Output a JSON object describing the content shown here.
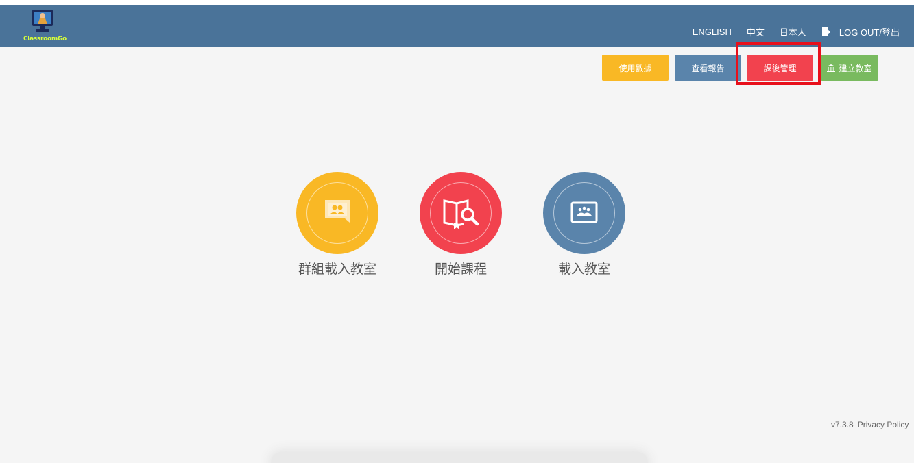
{
  "app": {
    "logo_text": "ClassroomGo"
  },
  "nav": {
    "english": "ENGLISH",
    "chinese": "中文",
    "japanese": "日本人",
    "logout": "LOG OUT/登出"
  },
  "actions": {
    "usage": "使用數據",
    "report": "查看報告",
    "after_class": "課後管理",
    "create_classroom": "建立教室"
  },
  "tiles": [
    {
      "label": "群組載入教室",
      "icon": "group-classroom-icon",
      "color": "#f9b825"
    },
    {
      "label": "開始課程",
      "icon": "book-search-icon",
      "color": "#f2424e"
    },
    {
      "label": "載入教室",
      "icon": "classroom-board-icon",
      "color": "#5a84ab"
    }
  ],
  "footer": {
    "version": "v7.3.8",
    "privacy": "Privacy Policy"
  },
  "colors": {
    "header": "#4a7399",
    "yellow": "#f9b825",
    "blue": "#5a84ab",
    "red": "#f2424e",
    "green": "#79ba5f",
    "highlight": "#e8101b"
  }
}
